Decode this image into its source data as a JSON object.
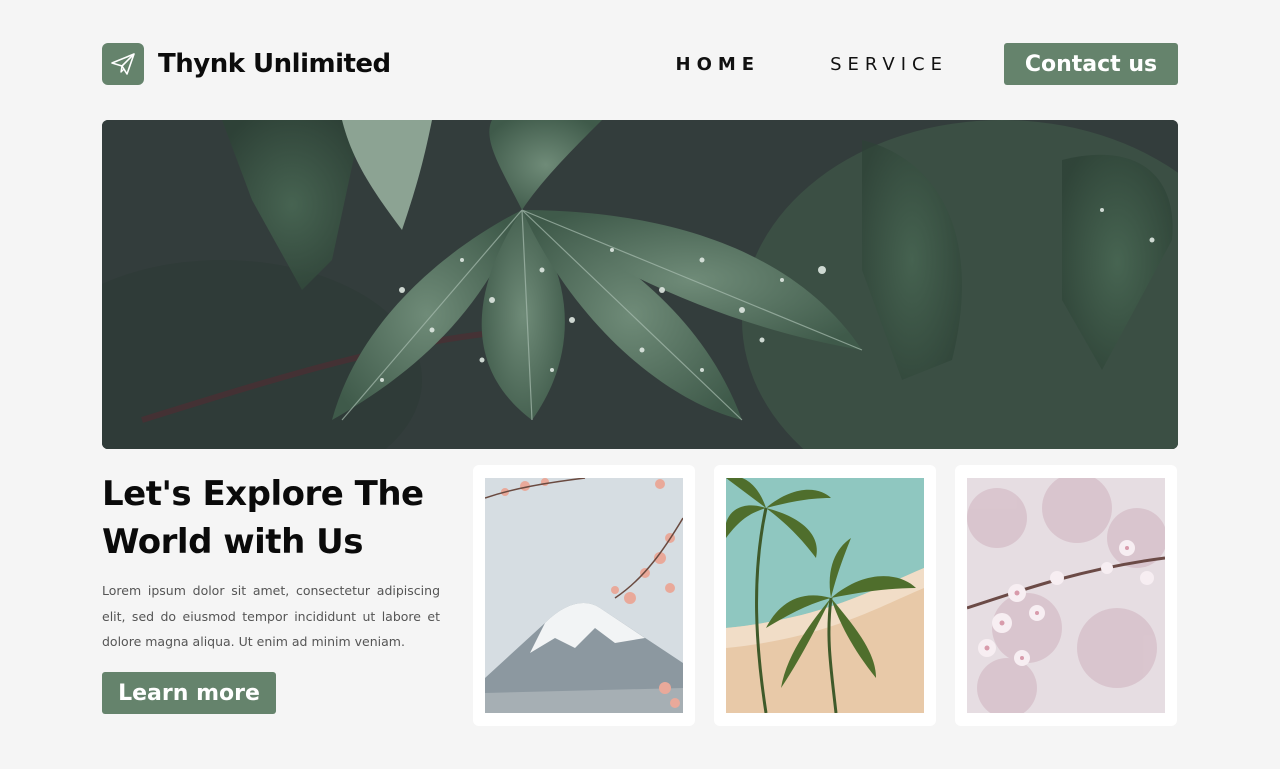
{
  "brand": {
    "name": "Thynk Unlimited",
    "logo_icon": "paper-plane-icon",
    "accent_color": "#65836c"
  },
  "nav": {
    "home_label": "HOME",
    "service_label": "SERVICE",
    "contact_label": "Contact us"
  },
  "hero": {
    "image": "rain-drops-on-leaves-photo"
  },
  "intro": {
    "headline": "Let's Explore The World with Us",
    "body": "Lorem ipsum dolor sit amet, consectetur adipiscing elit, sed do eiusmod tempor incididunt ut labore et dolore magna aliqua. Ut enim ad minim veniam.",
    "cta_label": "Learn more"
  },
  "gallery": [
    {
      "image": "mount-fuji-cherry-blossom-photo"
    },
    {
      "image": "palm-trees-beach-photo"
    },
    {
      "image": "cherry-blossom-closeup-photo"
    }
  ]
}
